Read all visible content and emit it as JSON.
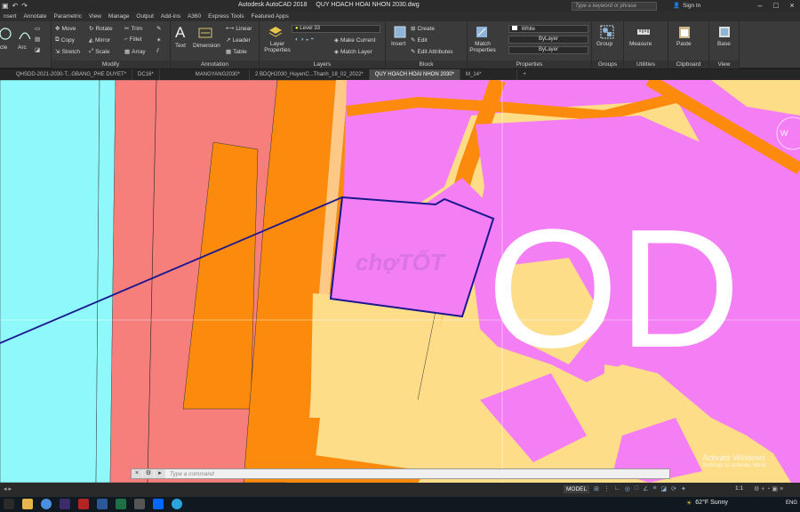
{
  "title_bar": {
    "app_name": "Autodesk AutoCAD 2018",
    "file_name": "QUY HOACH HOAI NHON 2030.dwg",
    "search_placeholder": "Type a keyword or phrase",
    "sign_in": "Sign In"
  },
  "menu_tabs": [
    "nsert",
    "Annotate",
    "Parametric",
    "View",
    "Manage",
    "Output",
    "Add-ins",
    "A360",
    "Express Tools",
    "Featured Apps"
  ],
  "ribbon": {
    "draw": {
      "circle": "cle",
      "arc": "Arc"
    },
    "modify": {
      "title": "Modify",
      "move": "Move",
      "rotate": "Rotate",
      "trim": "Trim",
      "copy": "Copy",
      "mirror": "Mirror",
      "fillet": "Fillet",
      "stretch": "Stretch",
      "scale": "Scale",
      "array": "Array"
    },
    "annotation": {
      "title": "Annotation",
      "text": "Text",
      "dimension": "Dimension",
      "linear": "Linear",
      "leader": "Leader",
      "table": "Table"
    },
    "layers": {
      "title": "Layers",
      "layer_properties": "Layer Properties",
      "current_layer": "Level 33",
      "make_current": "Make Current",
      "match_layer": "Match Layer"
    },
    "block": {
      "title": "Block",
      "insert": "Insert",
      "create": "Create",
      "edit": "Edit",
      "edit_attributes": "Edit Attributes"
    },
    "properties": {
      "title": "Properties",
      "match_properties": "Match Properties",
      "color": "White",
      "linetype": "ByLayer",
      "lineweight": "ByLayer"
    },
    "groups": {
      "title": "Groups",
      "group": "Group"
    },
    "utilities": {
      "title": "Utilities",
      "measure": "Measure"
    },
    "clipboard": {
      "title": "Clipboard",
      "paste": "Paste"
    },
    "view": {
      "title": "View",
      "base": "Base"
    }
  },
  "doc_tabs": [
    "QHSDD-2021-2030-T...GBANG_PHE DUYET*",
    "DC16*",
    "MANGYANG2030*",
    "2 BDQH2030_HuyenC...Thanh_18_02_2022*",
    "QUY HOACH HOAI NHON 2030*",
    "M_14*"
  ],
  "active_doc_tab_index": 4,
  "drawing": {
    "zone_label": "OD",
    "watermark_text": "chợTỐT",
    "compass_label": "W",
    "colors": {
      "cyan": "#8ef8fb",
      "salmon": "#f67f7b",
      "orange": "#fb8a0d",
      "magenta": "#f47ef4",
      "yellow": "#fedd89",
      "boundary": "#1a178f"
    }
  },
  "command_line": {
    "placeholder": "Type a command"
  },
  "status_bar": {
    "model": "MODEL",
    "scale": "1:1"
  },
  "activate_windows": {
    "title": "Activate Windows",
    "subtitle": "Settings to activate Wind"
  },
  "taskbar": {
    "weather": "62°F  Sunny",
    "language": "ENG"
  }
}
